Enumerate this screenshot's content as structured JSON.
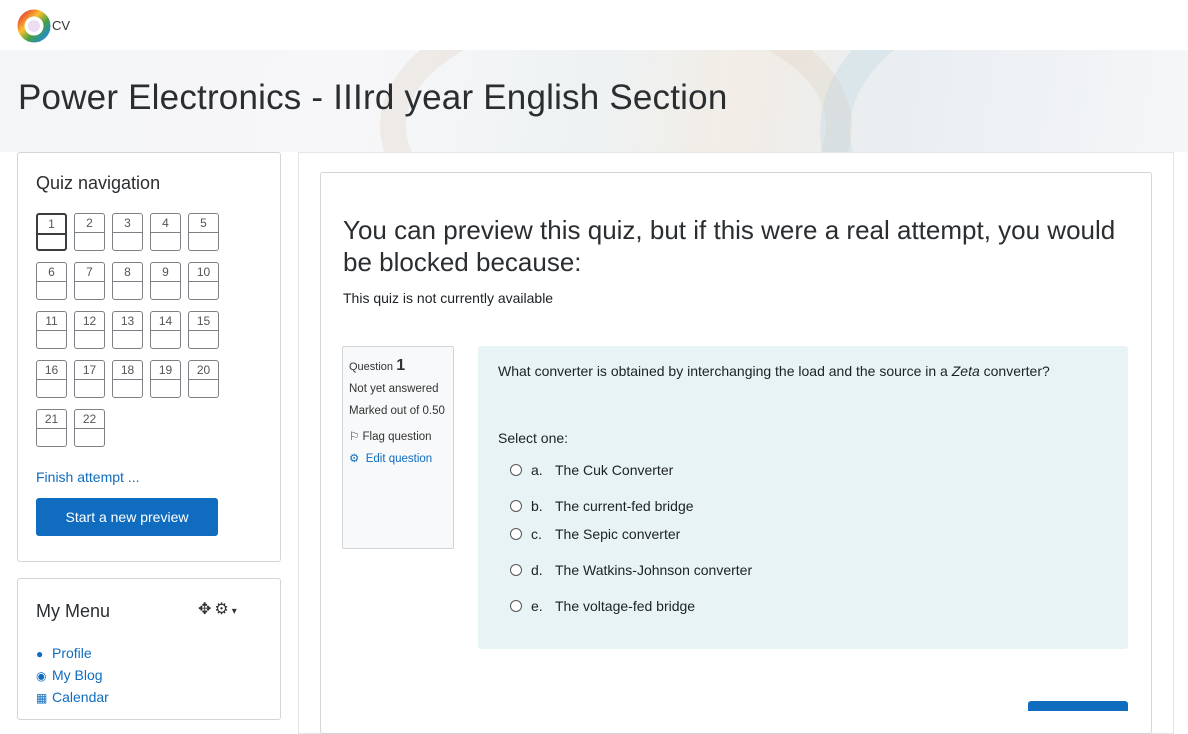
{
  "brand": {
    "logo_text": "CV"
  },
  "page": {
    "title": "Power Electronics - IIIrd year English Section"
  },
  "quiz_navigation": {
    "title": "Quiz navigation",
    "current_question": "1",
    "buttons": [
      "1",
      "2",
      "3",
      "4",
      "5",
      "6",
      "7",
      "8",
      "9",
      "10",
      "11",
      "12",
      "13",
      "14",
      "15",
      "16",
      "17",
      "18",
      "19",
      "20",
      "21",
      "22"
    ],
    "finish_label": "Finish attempt ...",
    "start_preview_label": "Start a new preview"
  },
  "my_menu": {
    "title": "My Menu",
    "items": [
      {
        "label": "Profile",
        "icon": "user-icon"
      },
      {
        "label": "My Blog",
        "icon": "globe-icon"
      },
      {
        "label": "Calendar",
        "icon": "calendar-icon"
      }
    ]
  },
  "main": {
    "blocked_message": "You can preview this quiz, but if this were a real attempt, you would be blocked because:",
    "not_available": "This quiz is not currently available"
  },
  "question": {
    "label": "Question",
    "number": "1",
    "status": "Not yet answered",
    "marks": "Marked out of 0.50",
    "flag_label": "Flag question",
    "edit_label": "Edit question",
    "text_before": "What converter is obtained by interchanging the load and the source in a ",
    "text_emph": "Zeta",
    "text_after": " converter?",
    "select_one": "Select one:",
    "options": [
      {
        "letter": "a.",
        "text": "The Cuk Converter"
      },
      {
        "letter": "b.",
        "text": "The current-fed bridge"
      },
      {
        "letter": "c.",
        "text": "The Sepic converter"
      },
      {
        "letter": "d.",
        "text": "The Watkins-Johnson converter"
      },
      {
        "letter": "e.",
        "text": "The voltage-fed bridge"
      }
    ]
  },
  "colors": {
    "accent": "#0f6cbf",
    "question_bg": "#e7f3f5"
  }
}
